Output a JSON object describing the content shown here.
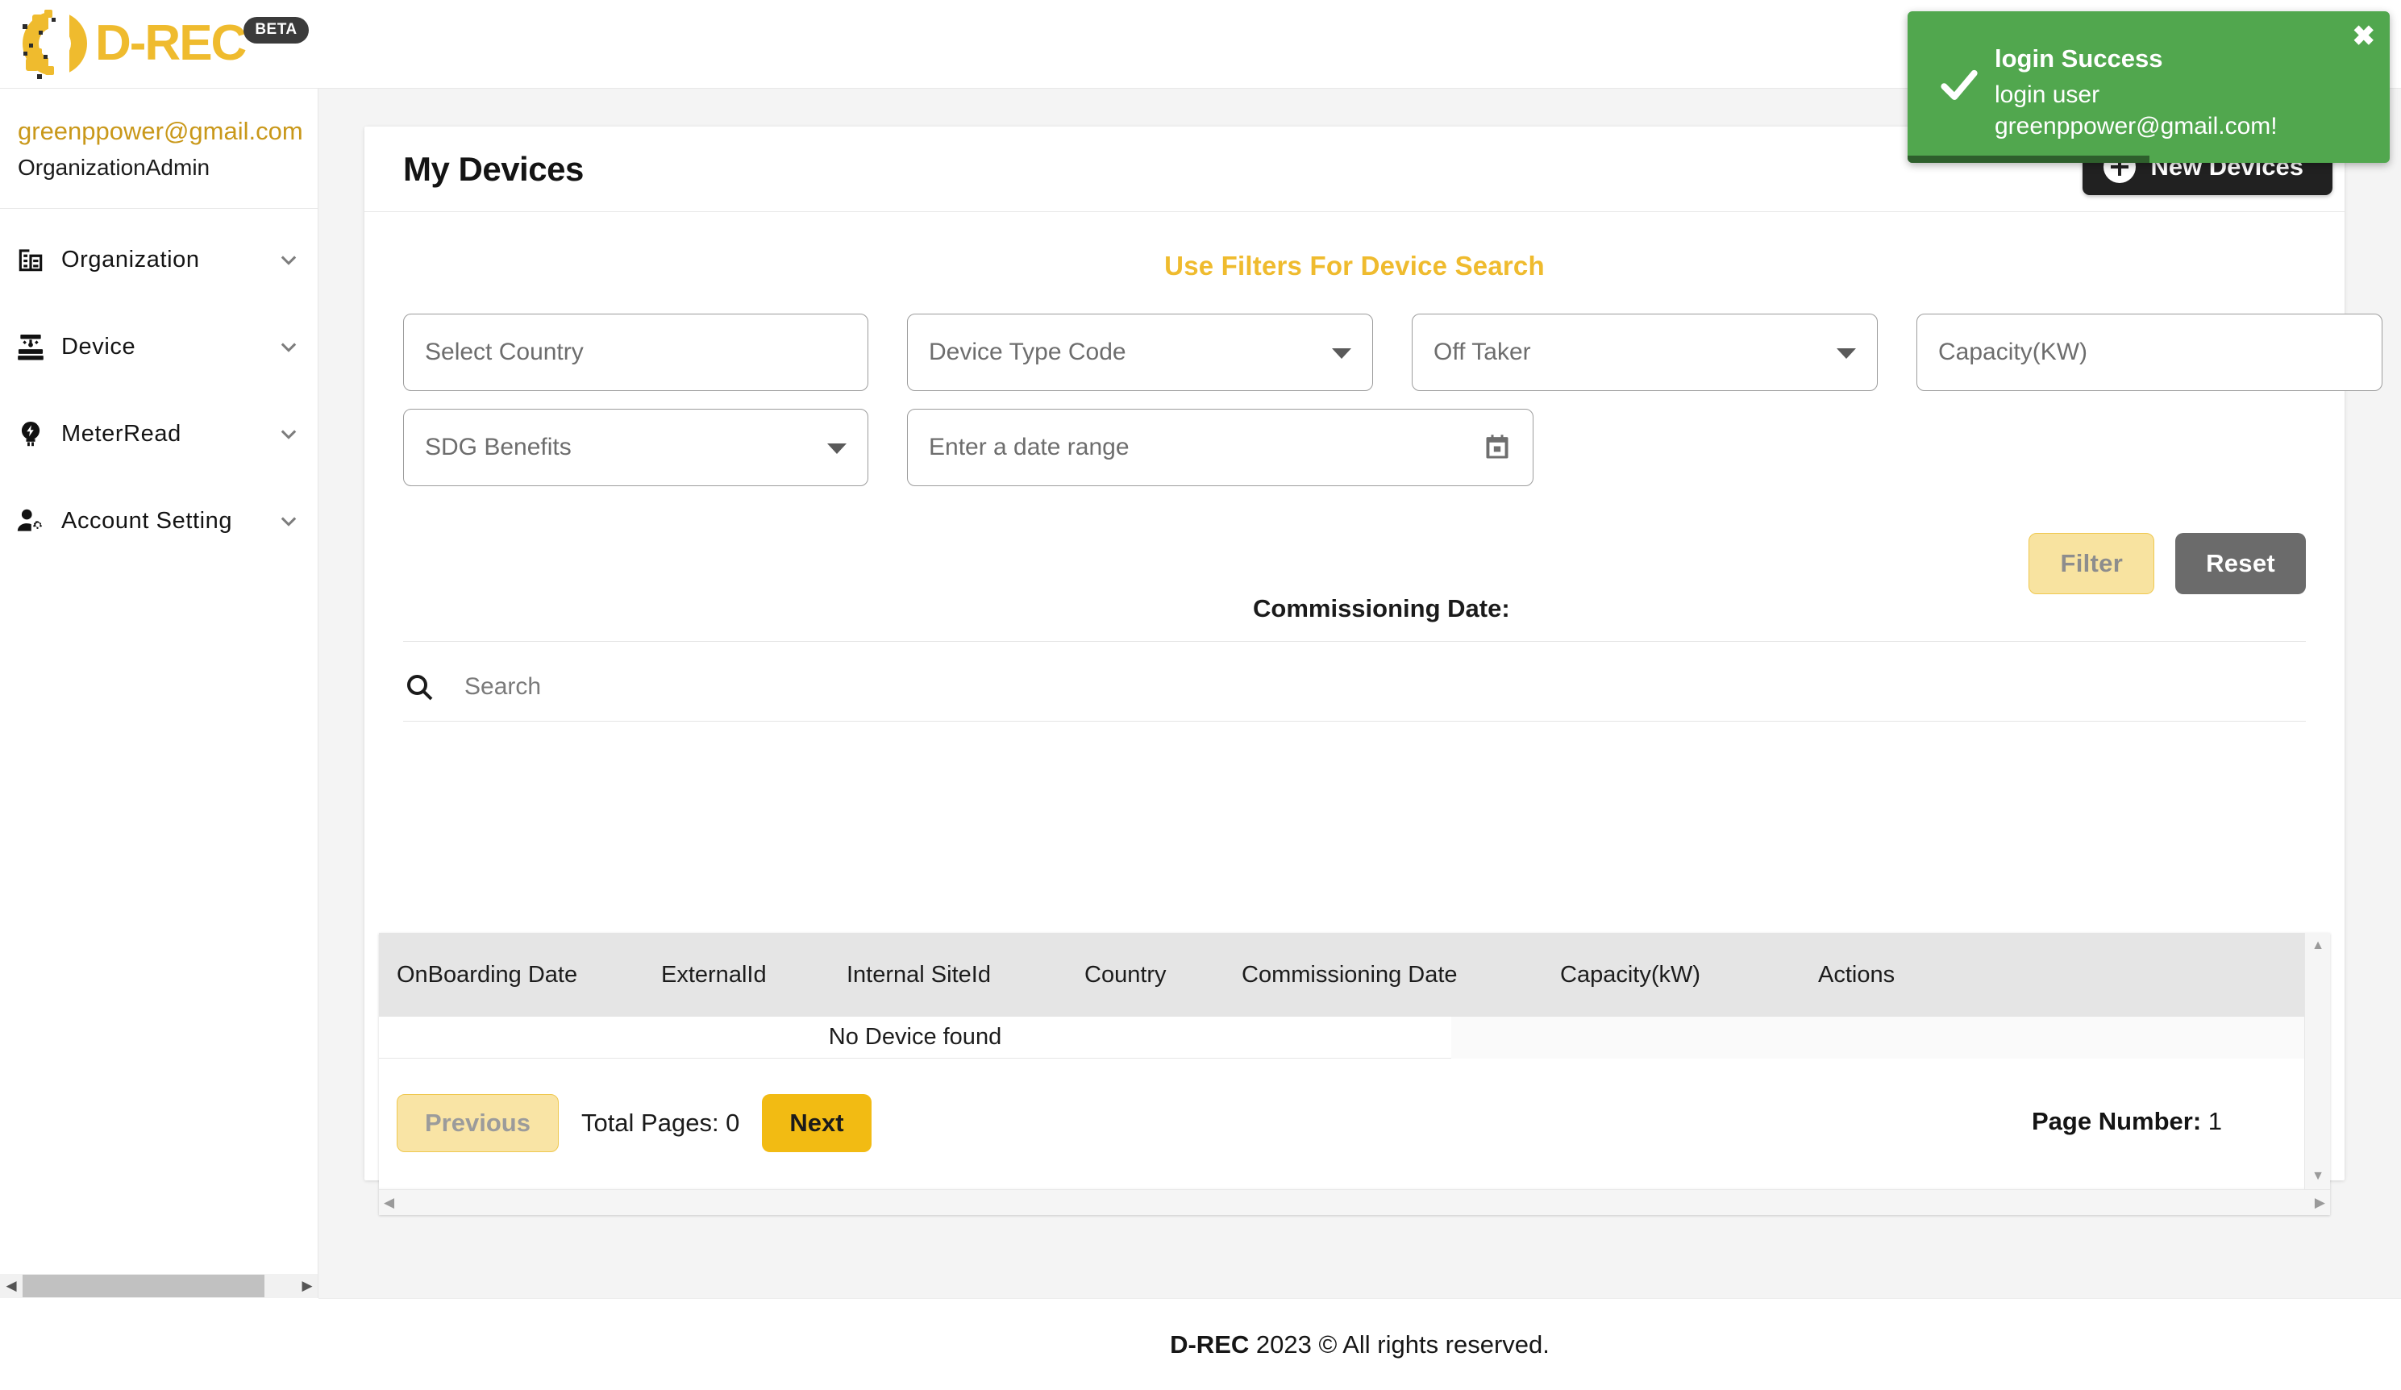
{
  "brand": {
    "name": "D-REC",
    "badge": "BETA",
    "accent_gold": "#EFBB2E",
    "accent_gold_solid": "#F2BB13",
    "dark": "#212121",
    "success_green": "#51A74E"
  },
  "sidebar": {
    "email": "greenppower@gmail.com",
    "role": "OrganizationAdmin",
    "items": [
      {
        "label": "Organization",
        "icon": "organization-icon"
      },
      {
        "label": "Device",
        "icon": "device-icon"
      },
      {
        "label": "MeterRead",
        "icon": "meter-icon"
      },
      {
        "label": "Account Setting",
        "icon": "account-setting-icon"
      }
    ]
  },
  "card": {
    "title": "My Devices",
    "new_devices_label": "New Devices"
  },
  "filters": {
    "heading": "Use Filters For Device Search",
    "country_placeholder": "Select Country",
    "device_type_placeholder": "Device Type Code",
    "off_taker_placeholder": "Off Taker",
    "capacity_placeholder": "Capacity(KW)",
    "sdg_placeholder": "SDG Benefits",
    "commissioning_label": "Commissioning Date:",
    "date_range_placeholder": "Enter a date range",
    "filter_label": "Filter",
    "reset_label": "Reset"
  },
  "search": {
    "placeholder": "Search",
    "value": ""
  },
  "table": {
    "columns": [
      "OnBoarding Date",
      "ExternalId",
      "Internal SiteId",
      "Country",
      "Commissioning Date",
      "Capacity(kW)",
      "Actions"
    ],
    "rows": [],
    "empty_message": "No Device found"
  },
  "pagination": {
    "previous_label": "Previous",
    "next_label": "Next",
    "total_pages_label": "Total Pages: 0",
    "page_number_label": "Page Number:",
    "page_number_value": "1"
  },
  "toast": {
    "title": "login Success",
    "message": "login user greenppower@gmail.com!",
    "close_glyph": "✖",
    "icon": "check-icon"
  },
  "footer": {
    "brand": "D-REC",
    "text": " 2023 © All rights reserved."
  }
}
